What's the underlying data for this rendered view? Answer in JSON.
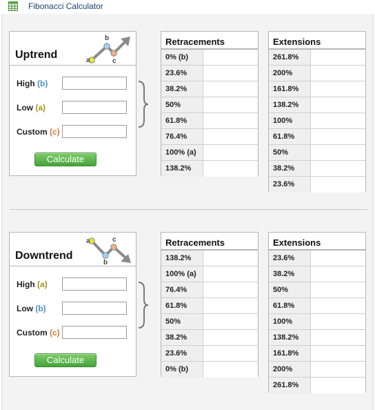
{
  "app": {
    "title": "Fibonacci Calculator",
    "icon": "spreadsheet-icon"
  },
  "uptrend": {
    "title": "Uptrend",
    "icon": {
      "name": "uptrend-chart-icon",
      "points": [
        "a",
        "b",
        "c"
      ]
    },
    "fields": [
      {
        "label": "High",
        "tag": "(b)",
        "value": "",
        "placeholder": ""
      },
      {
        "label": "Low",
        "tag": "(a)",
        "value": "",
        "placeholder": ""
      },
      {
        "label": "Custom",
        "tag": "(c)",
        "value": "",
        "placeholder": ""
      }
    ],
    "calculate_label": "Calculate",
    "retracements": {
      "header": "Retracements",
      "rows": [
        "0% (b)",
        "23.6%",
        "38.2%",
        "50%",
        "61.8%",
        "76.4%",
        "100% (a)",
        "138.2%"
      ],
      "values": [
        "",
        "",
        "",
        "",
        "",
        "",
        "",
        ""
      ]
    },
    "extensions": {
      "header": "Extensions",
      "rows": [
        "261.8%",
        "200%",
        "161.8%",
        "138.2%",
        "100%",
        "61.8%",
        "50%",
        "38.2%",
        "23.6%"
      ],
      "values": [
        "",
        "",
        "",
        "",
        "",
        "",
        "",
        "",
        ""
      ]
    }
  },
  "downtrend": {
    "title": "Downtrend",
    "icon": {
      "name": "downtrend-chart-icon",
      "points": [
        "a",
        "b",
        "c"
      ]
    },
    "fields": [
      {
        "label": "High",
        "tag": "(a)",
        "value": "",
        "placeholder": ""
      },
      {
        "label": "Low",
        "tag": "(b)",
        "value": "",
        "placeholder": ""
      },
      {
        "label": "Custom",
        "tag": "(c)",
        "value": "",
        "placeholder": ""
      }
    ],
    "calculate_label": "Calculate",
    "retracements": {
      "header": "Retracements",
      "rows": [
        "138.2%",
        "100% (a)",
        "76.4%",
        "61.8%",
        "50%",
        "38.2%",
        "23.6%",
        "0% (b)"
      ],
      "values": [
        "",
        "",
        "",
        "",
        "",
        "",
        "",
        ""
      ]
    },
    "extensions": {
      "header": "Extensions",
      "rows": [
        "23.6%",
        "38.2%",
        "50%",
        "61.8%",
        "100%",
        "138.2%",
        "161.8%",
        "200%",
        "261.8%"
      ],
      "values": [
        "",
        "",
        "",
        "",
        "",
        "",
        "",
        "",
        ""
      ]
    }
  },
  "colors": {
    "point_a": "#d9d935",
    "point_b": "#8fc3e8",
    "point_c": "#e8a27a",
    "button_green": "#45a33b",
    "title_blue": "#1c3f6e"
  }
}
